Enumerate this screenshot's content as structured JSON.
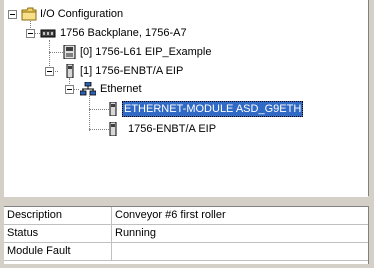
{
  "tree": {
    "io_config": "I/O Configuration",
    "backplane": "1756 Backplane, 1756-A7",
    "slot0": "[0] 1756-L61 EIP_Example",
    "slot1": "[1] 1756-ENBT/A EIP",
    "ethernet": "Ethernet",
    "module_selected": "ETHERNET-MODULE ASD_G9ETH",
    "module2": "1756-ENBT/A EIP"
  },
  "properties": {
    "rows": [
      {
        "key": "Description",
        "value": "Conveyor #6 first roller"
      },
      {
        "key": "Status",
        "value": "Running"
      },
      {
        "key": "Module Fault",
        "value": ""
      }
    ]
  },
  "colors": {
    "selection": "#316ac5",
    "window_bg": "#d4d0c8",
    "folder": "#f0d060"
  }
}
